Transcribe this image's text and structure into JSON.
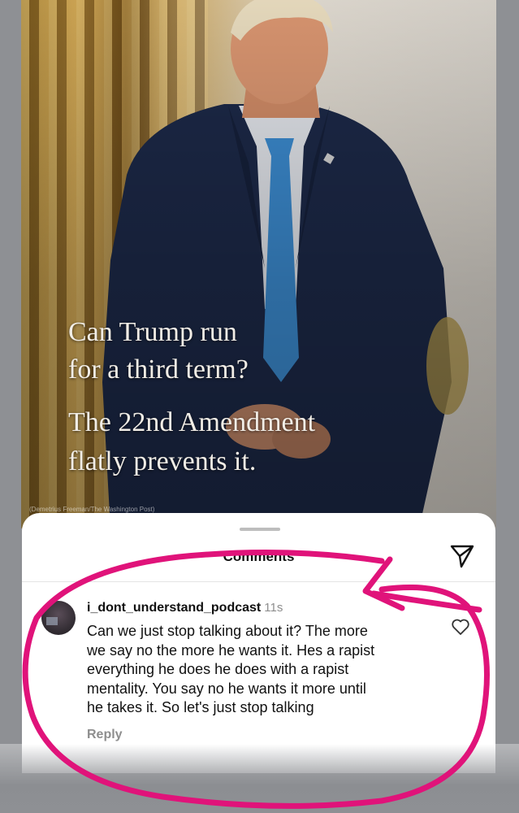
{
  "story": {
    "headline_line1": "Can Trump run",
    "headline_line2": "for a third term?",
    "subhead_line1": "The 22nd Amendment",
    "subhead_line2": "flatly prevents it.",
    "photo_credit": "(Demetrius Freeman/The Washington Post)"
  },
  "comments_sheet": {
    "title": "Comments",
    "share_icon": "paper-plane-icon",
    "comment": {
      "username": "i_dont_understand_podcast",
      "timestamp": "11s",
      "text_lines": [
        "Can we just stop talking about it? The more",
        "we say no the more he wants it. Hes a rapist",
        "everything he does he does with a rapist",
        "mentality. You say no he wants it more until",
        "he takes it. So let's just stop talking"
      ],
      "reply_label": "Reply",
      "like_icon": "heart-outline-icon"
    }
  },
  "colors": {
    "annotation_magenta": "#e0137a",
    "background_gray": "#8e9094",
    "suit_navy": "#1d2a4a",
    "tie_blue": "#3d8fd6"
  }
}
